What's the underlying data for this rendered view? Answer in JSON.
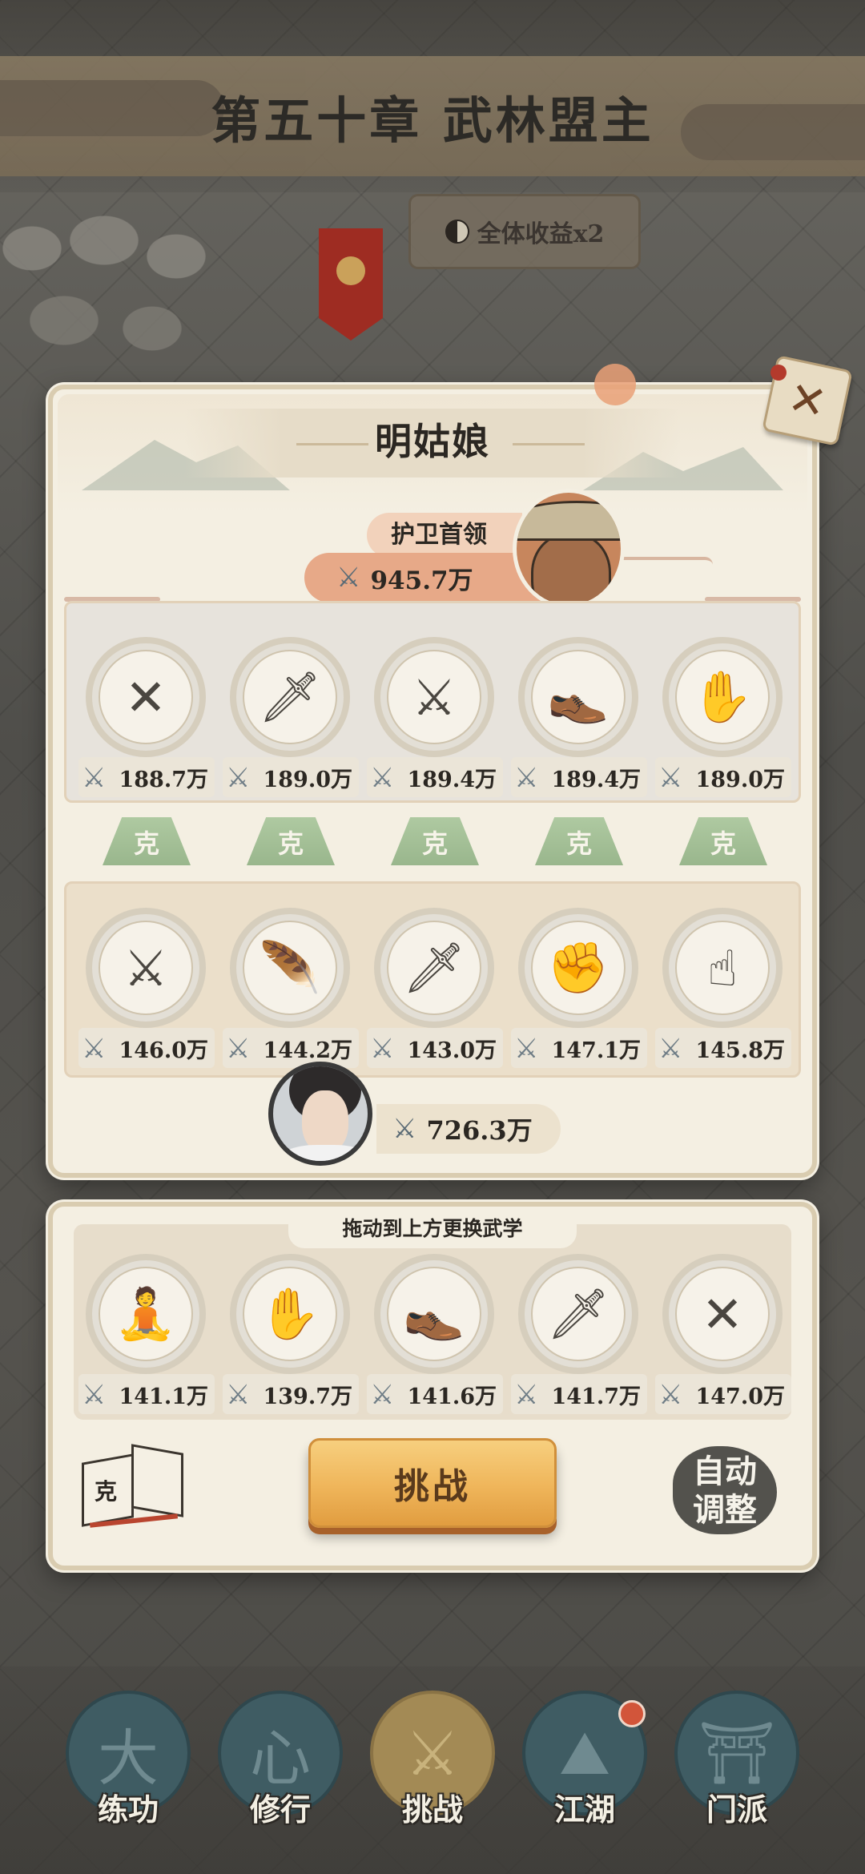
{
  "header": {
    "chapter_title": "第五十章 武林盟主",
    "bonus_label": "全体收益x2"
  },
  "battle": {
    "opponent_name": "明姑娘",
    "enemy": {
      "title": "护卫首领",
      "total_power": "945.7万",
      "skills": [
        {
          "icon": "crossed-spears-icon",
          "glyph": "✕",
          "power": "188.7万"
        },
        {
          "icon": "saber-icon",
          "glyph": "🗡",
          "power": "189.0万"
        },
        {
          "icon": "throwing-knives-icon",
          "glyph": "⚔",
          "power": "189.4万"
        },
        {
          "icon": "shoe-icon",
          "glyph": "👞",
          "power": "189.4万"
        },
        {
          "icon": "palm-icon",
          "glyph": "✋",
          "power": "189.0万"
        }
      ]
    },
    "counter_label": "克",
    "counters": [
      "克",
      "克",
      "克",
      "克",
      "克"
    ],
    "player": {
      "total_power": "726.3万",
      "skills": [
        {
          "icon": "throwing-knives-icon",
          "glyph": "⚔",
          "power": "146.0万"
        },
        {
          "icon": "feather-icon",
          "glyph": "🪶",
          "power": "144.2万"
        },
        {
          "icon": "saber-icon",
          "glyph": "🗡",
          "power": "143.0万"
        },
        {
          "icon": "fist-icon",
          "glyph": "✊",
          "power": "147.1万"
        },
        {
          "icon": "finger-icon",
          "glyph": "☝",
          "power": "145.8万"
        }
      ]
    }
  },
  "inventory": {
    "hint": "拖动到上方更换武学",
    "skills": [
      {
        "icon": "meditation-icon",
        "glyph": "🧘",
        "power": "141.1万"
      },
      {
        "icon": "palm-icon",
        "glyph": "✋",
        "power": "139.7万"
      },
      {
        "icon": "shoe-icon",
        "glyph": "👞",
        "power": "141.6万"
      },
      {
        "icon": "sword-icon",
        "glyph": "🗡",
        "power": "141.7万"
      },
      {
        "icon": "crossed-spears-icon",
        "glyph": "✕",
        "power": "147.0万"
      }
    ]
  },
  "actions": {
    "challenge_label": "挑战",
    "auto_line1": "自动",
    "auto_line2": "调整",
    "book_glyph": "克"
  },
  "nav": {
    "items": [
      {
        "label": "练功",
        "icon": "martial-figure-icon",
        "glyph": "大",
        "active": false
      },
      {
        "label": "修行",
        "icon": "heart-icon",
        "glyph": "心",
        "active": false
      },
      {
        "label": "挑战",
        "icon": "crossed-swords-icon",
        "glyph": "⚔",
        "active": true
      },
      {
        "label": "江湖",
        "icon": "mountain-icon",
        "glyph": "⛰",
        "active": false
      },
      {
        "label": "门派",
        "icon": "gate-icon",
        "glyph": "⛩",
        "active": false
      }
    ]
  },
  "colors": {
    "counter_green": "#8fb083",
    "challenge_orange": "#efb55a",
    "panel_cream": "#f4efe2"
  }
}
